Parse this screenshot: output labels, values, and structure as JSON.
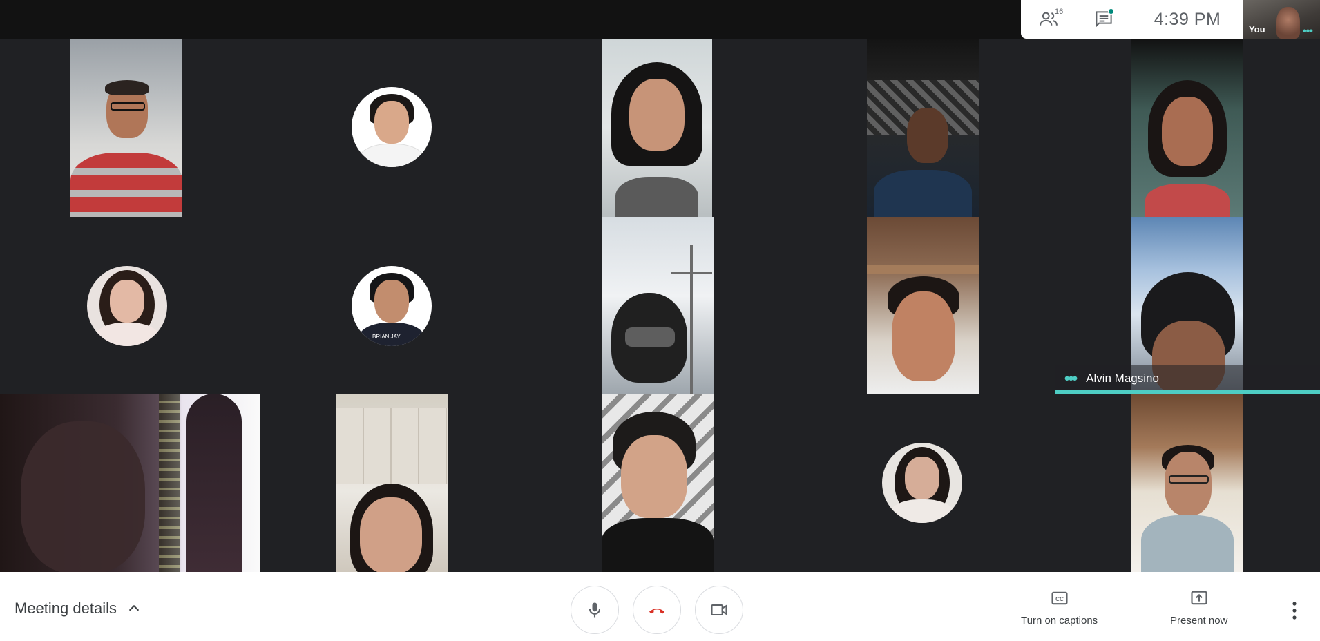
{
  "topbar": {
    "participants_count": "16",
    "clock": "4:39  PM",
    "self_label": "You",
    "self_more": "•••"
  },
  "speaker": {
    "name": "Alvin Magsino",
    "indicator": "•••"
  },
  "avatar_badges": {
    "name_on_photo": "BRIAN JAY"
  },
  "bottombar": {
    "meeting_details_label": "Meeting details",
    "captions_label": "Turn on captions",
    "present_label": "Present now"
  },
  "colors": {
    "accent_teal": "#4ecdc4",
    "hangup_red": "#d93025",
    "chat_dot": "#00897b",
    "background": "#202124"
  },
  "icons": [
    "people-icon",
    "chat-icon",
    "chevron-up-icon",
    "microphone-icon",
    "hang-up-icon",
    "camera-icon",
    "captions-icon",
    "present-icon",
    "more-vert-icon"
  ]
}
